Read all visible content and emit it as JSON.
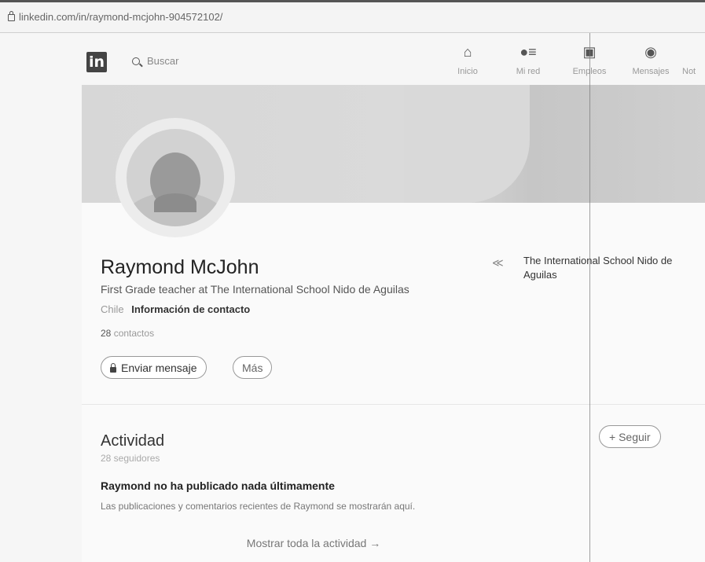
{
  "browser": {
    "url": "linkedin.com/in/raymond-mcjohn-904572102/"
  },
  "nav": {
    "logo": "in",
    "search_placeholder": "Buscar",
    "items": [
      {
        "label": "Inicio",
        "icon": "home-icon"
      },
      {
        "label": "Mi red",
        "icon": "network-icon"
      },
      {
        "label": "Empleos",
        "icon": "briefcase-icon"
      },
      {
        "label": "Mensajes",
        "icon": "messages-icon"
      },
      {
        "label": "Not",
        "icon": "notifications-icon"
      }
    ]
  },
  "profile": {
    "name": "Raymond McJohn",
    "headline": "First Grade teacher at The International School Nido de Aguilas",
    "location": "Chile",
    "contact_link": "Información de contacto",
    "connections_count": "28",
    "connections_label": "contactos",
    "message_button": "Enviar mensaje",
    "more_button": "Más",
    "school": "The International School Nido de Aguilas"
  },
  "activity": {
    "title": "Actividad",
    "followers": "28 seguidores",
    "follow_button": "+ Seguir",
    "empty_title": "Raymond no ha publicado nada últimamente",
    "empty_desc": "Las publicaciones y comentarios recientes de Raymond se mostrarán aquí.",
    "show_all": "Mostrar toda la actividad →"
  }
}
